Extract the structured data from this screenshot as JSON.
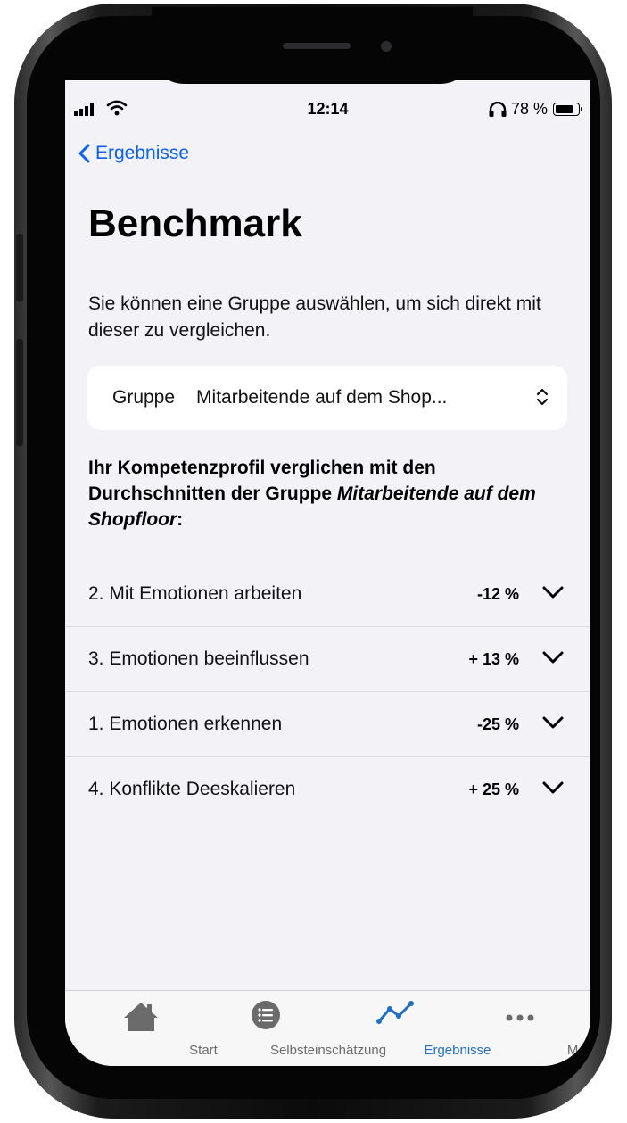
{
  "status_bar": {
    "time": "12:14",
    "battery": "78 %",
    "battery_level": 0.78
  },
  "nav": {
    "back_label": "Ergebnisse"
  },
  "page": {
    "title": "Benchmark",
    "intro": "Sie können eine Gruppe auswählen, um sich direkt mit dieser zu vergleichen."
  },
  "picker": {
    "label": "Gruppe",
    "value": "Mitarbeitende auf dem Shop..."
  },
  "heading": {
    "prefix": "Ihr Kompetenzprofil verglichen mit den Durchschnitten der Gruppe ",
    "group": "Mitarbeitende auf dem Shopfloor",
    "suffix": ":"
  },
  "competencies": [
    {
      "name": "2. Mit Emotionen arbeiten",
      "delta": "-12 %"
    },
    {
      "name": "3. Emotionen beeinflussen",
      "delta": "+ 13 %"
    },
    {
      "name": "1. Emotionen erkennen",
      "delta": "-25 %"
    },
    {
      "name": "4. Konflikte Deeskalieren",
      "delta": "+ 25 %"
    }
  ],
  "tabbar": {
    "tabs": [
      {
        "label": "Start",
        "icon": "house-icon"
      },
      {
        "label": "Selbsteinschätzung",
        "icon": "list-icon"
      },
      {
        "label": "Ergebnisse",
        "icon": "chart-line-icon"
      },
      {
        "label": "Mehr",
        "icon": "more-icon"
      }
    ],
    "active": "Ergebnisse"
  },
  "colors": {
    "accent": "#0a60ff",
    "tab_active": "#1f6fc8",
    "background": "#f2f2f7"
  }
}
